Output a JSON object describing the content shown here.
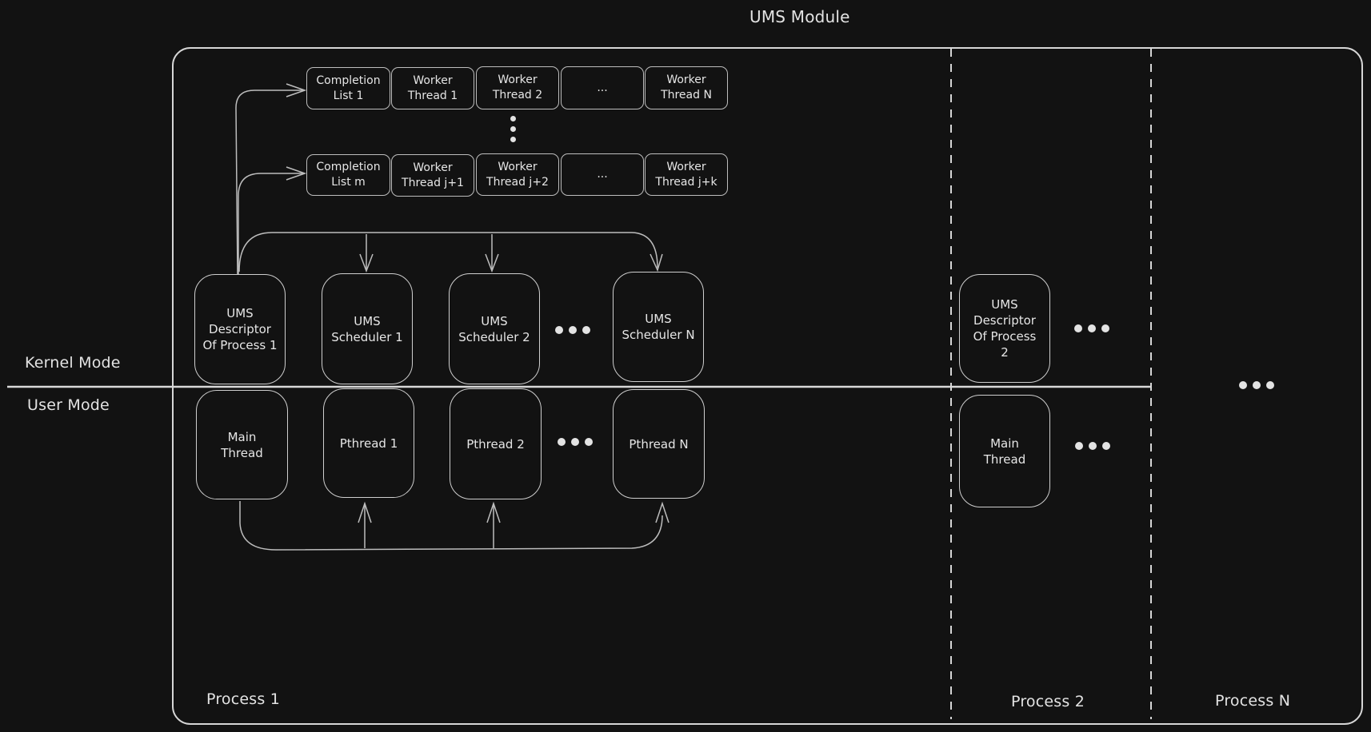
{
  "title": "UMS Module",
  "modes": {
    "kernel": "Kernel Mode",
    "user": "User Mode"
  },
  "processes": [
    {
      "label": "Process 1",
      "kernel_boxes": [
        "UMS\nDescriptor\nOf Process 1",
        "UMS\nScheduler 1",
        "UMS\nScheduler 2",
        "UMS\nScheduler N"
      ],
      "user_boxes": [
        "Main\nThread",
        "Pthread 1",
        "Pthread 2",
        "Pthread N"
      ],
      "completion_lists": [
        {
          "cells": [
            "Completion\nList 1",
            "Worker\nThread 1",
            "Worker\nThread 2",
            "...",
            "Worker\nThread N"
          ]
        },
        {
          "cells": [
            "Completion\nList m",
            "Worker\nThread j+1",
            "Worker\nThread j+2",
            "...",
            "Worker\nThread j+k"
          ]
        }
      ]
    },
    {
      "label": "Process 2",
      "kernel_boxes": [
        "UMS\nDescriptor\nOf Process\n2"
      ],
      "user_boxes": [
        "Main\nThread"
      ]
    },
    {
      "label": "Process N"
    }
  ],
  "colors": {
    "background": "#121212",
    "stroke": "#cfcfcf",
    "text": "#e6e6e6"
  }
}
